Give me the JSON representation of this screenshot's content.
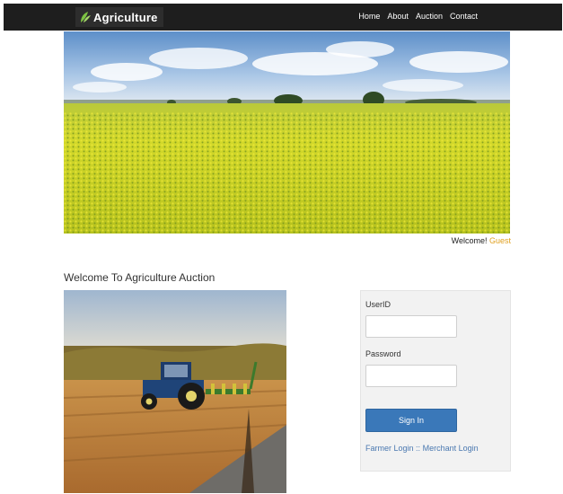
{
  "navbar": {
    "brand": "Agriculture",
    "links": [
      "Home",
      "About",
      "Auction",
      "Contact"
    ]
  },
  "welcome": {
    "prefix": "Welcome!",
    "user": "Guest"
  },
  "section_title": "Welcome To Agriculture Auction",
  "login": {
    "userid_label": "UserID",
    "userid_value": "",
    "password_label": "Password",
    "password_value": "",
    "signin_label": "Sign In",
    "farmer_link": "Farmer Login",
    "separator": "::",
    "merchant_link": "Merchant Login"
  },
  "colors": {
    "navbar": "#1e1e1e",
    "accent": "#3a78b9",
    "guest": "#e0a020",
    "link": "#4a78b0"
  },
  "icons": {
    "brand": "leaf-icon"
  }
}
